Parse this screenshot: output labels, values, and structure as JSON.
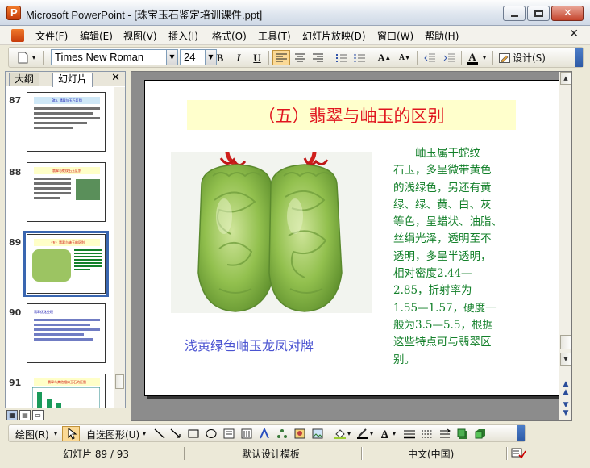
{
  "window": {
    "title": "Microsoft PowerPoint - [珠宝玉石鉴定培训课件.ppt]"
  },
  "menu": {
    "items": [
      "文件(F)",
      "编辑(E)",
      "视图(V)",
      "插入(I)",
      "格式(O)",
      "工具(T)",
      "幻灯片放映(D)",
      "窗口(W)",
      "帮助(H)"
    ]
  },
  "toolbar": {
    "font_name": "Times New Roman",
    "font_size": "24",
    "bold": "B",
    "italic": "I",
    "underline": "U",
    "font_color_label": "A",
    "design_label": "设计(S)"
  },
  "pane": {
    "tabs": [
      "大纲",
      "幻灯片"
    ],
    "active_tab": "幻灯片",
    "thumbnails": [
      {
        "number": "87",
        "title": "Btn. 翡翠与玉石区别"
      },
      {
        "number": "88",
        "title": "翡翠与蛇纹石玉区别"
      },
      {
        "number": "89",
        "title": "（五）翡翠与岫玉的区别"
      },
      {
        "number": "90",
        "title": "翡翠优化处理"
      },
      {
        "number": "91",
        "title": "翡翠与其他相似玉石的区别"
      }
    ],
    "selected_index": 2
  },
  "slide": {
    "title": "（五）翡翠与岫玉的区别",
    "caption": "浅黄绿色岫玉龙凤对牌",
    "body_lines": [
      "　　岫玉属于蛇纹",
      "石玉，多呈微带黄色",
      "的浅绿色，另还有黄",
      "绿、绿、黄、白、灰",
      "等色，呈蜡状、油脂、",
      "丝绢光泽，透明至不",
      "透明，多呈半透明，",
      "相对密度2.44—",
      "2.85，折射率为",
      "1.55—1.57，硬度一",
      "般为3.5—5.5，根据",
      "这些特点可与翡翠区",
      "别。"
    ],
    "colors": {
      "title": "#e0141e",
      "title_bg": "#ffffcc",
      "body": "#13802a",
      "caption": "#4a53d1",
      "jade": "#8cbf4a"
    }
  },
  "drawbar": {
    "draw_label": "绘图(R)",
    "autoshape_label": "自选图形(U)"
  },
  "status": {
    "slide_position": "幻灯片 89 / 93",
    "template": "默认设计模板",
    "language": "中文(中国)"
  }
}
